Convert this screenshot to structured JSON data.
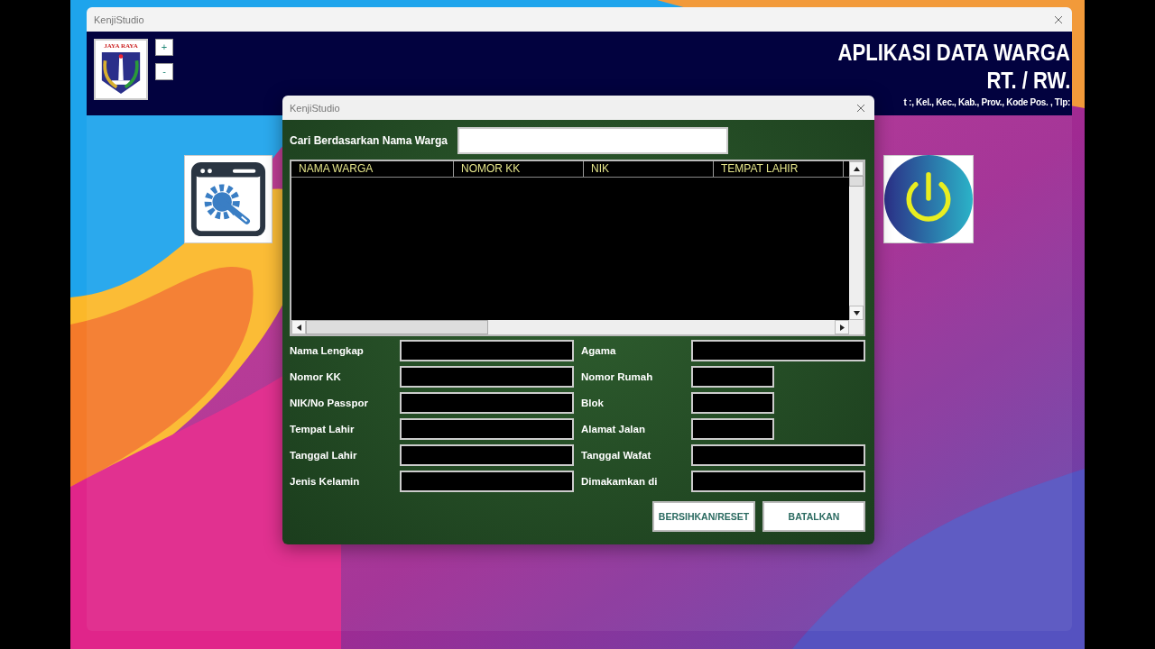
{
  "window": {
    "title": "KenjiStudio"
  },
  "header": {
    "logo_text": "JAYA RAYA",
    "title": "APLIKASI DATA WARGA",
    "subtitle": "RT. / RW.",
    "address": "t :, Kel., Kec., Kab., Prov., Kode Pos. , Tlp:"
  },
  "zoom_buttons": [
    "+",
    "-"
  ],
  "dialog": {
    "title": "KenjiStudio",
    "search": {
      "label": "Cari Berdasarkan Nama Warga"
    },
    "table": {
      "columns": [
        "NAMA WARGA",
        "NOMOR KK",
        "NIK",
        "TEMPAT LAHIR"
      ]
    },
    "left_fields": [
      {
        "label": "Nama Lengkap",
        "kind": "wide"
      },
      {
        "label": "Nomor KK",
        "kind": "wide"
      },
      {
        "label": "NIK/No Passpor",
        "kind": "wide"
      },
      {
        "label": "Tempat Lahir",
        "kind": "wide"
      },
      {
        "label": "Tanggal Lahir",
        "kind": "wide"
      },
      {
        "label": "Jenis Kelamin",
        "kind": "wide"
      }
    ],
    "right_fields": [
      {
        "label": "Agama",
        "kind": "wide"
      },
      {
        "label": "Nomor Rumah",
        "kind": "short"
      },
      {
        "label": "Blok",
        "kind": "short"
      },
      {
        "label": "Alamat Jalan",
        "kind": "short"
      },
      {
        "label": "Tanggal Wafat",
        "kind": "wide"
      },
      {
        "label": "Dimakamkan di",
        "kind": "wide"
      }
    ],
    "buttons": [
      "BERSIHKAN/RESET",
      "BATALKAN"
    ]
  }
}
